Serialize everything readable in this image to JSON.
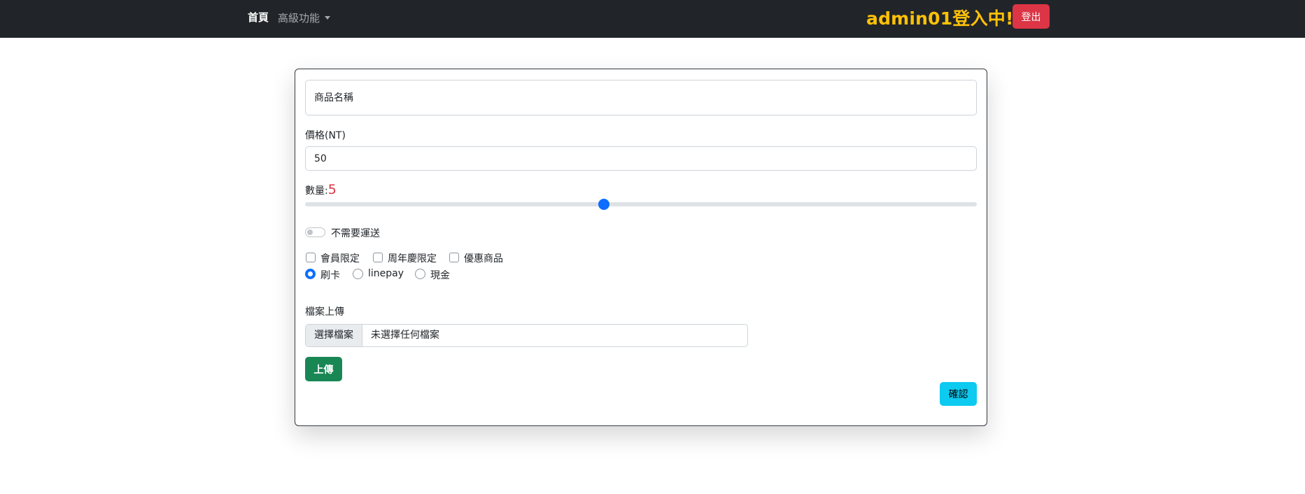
{
  "navbar": {
    "home_label": "首頁",
    "advanced_label": "高級功能",
    "user_status": "admin01登入中!",
    "logout_label": "登出"
  },
  "form": {
    "name": {
      "placeholder": "商品名稱",
      "value": ""
    },
    "price": {
      "label": "價格(NT)",
      "value": "50"
    },
    "quantity": {
      "label": "數量:",
      "value": "5",
      "level_percent": 44.5
    },
    "shipping_toggle": {
      "label": "不需要運送",
      "checked": false
    },
    "checkboxes": [
      {
        "label": "會員限定",
        "checked": false
      },
      {
        "label": "周年慶限定",
        "checked": false
      },
      {
        "label": "優惠商品",
        "checked": false
      }
    ],
    "payment_radios": [
      {
        "label": "刷卡",
        "checked": true
      },
      {
        "label": "linepay",
        "checked": false
      },
      {
        "label": "現金",
        "checked": false
      }
    ],
    "file_upload": {
      "label": "檔案上傳",
      "button_label": "選擇檔案",
      "status": "未選擇任何檔案"
    },
    "upload_label": "上傳",
    "confirm_label": "確認"
  },
  "colors": {
    "navbar_bg": "#212529",
    "user_status": "#ffc107",
    "logout": "#dc3545",
    "accent": "#0d6efd",
    "upload": "#198754",
    "confirm": "#0dcaf0",
    "quantity_value": "#dc3545"
  },
  "icons": {
    "dropdown": "caret-down-icon"
  }
}
